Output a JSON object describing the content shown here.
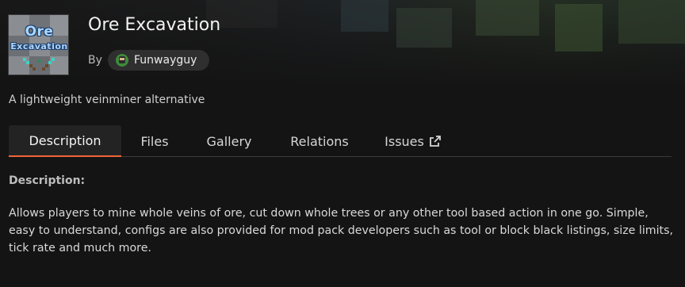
{
  "project": {
    "title": "Ore Excavation",
    "by_label": "By",
    "author": "Funwayguy",
    "summary": "A lightweight veinminer alternative",
    "logo_text": [
      "Ore",
      "Excavation"
    ]
  },
  "tabs": [
    {
      "label": "Description",
      "active": true
    },
    {
      "label": "Files",
      "active": false
    },
    {
      "label": "Gallery",
      "active": false
    },
    {
      "label": "Relations",
      "active": false
    },
    {
      "label": "Issues",
      "active": false,
      "icon": "external-link-icon"
    }
  ],
  "content": {
    "heading": "Description:",
    "body": "Allows players to mine whole veins of ore, cut down whole trees or any other tool based action in one go. Simple, easy to understand, configs are also provided for mod pack developers such as tool or block black listings, size limits, tick rate and much more."
  },
  "colors": {
    "background": "#141414",
    "accent": "#f16436",
    "chip": "#2f2f2f",
    "logo_text": "#a9d8ff"
  }
}
